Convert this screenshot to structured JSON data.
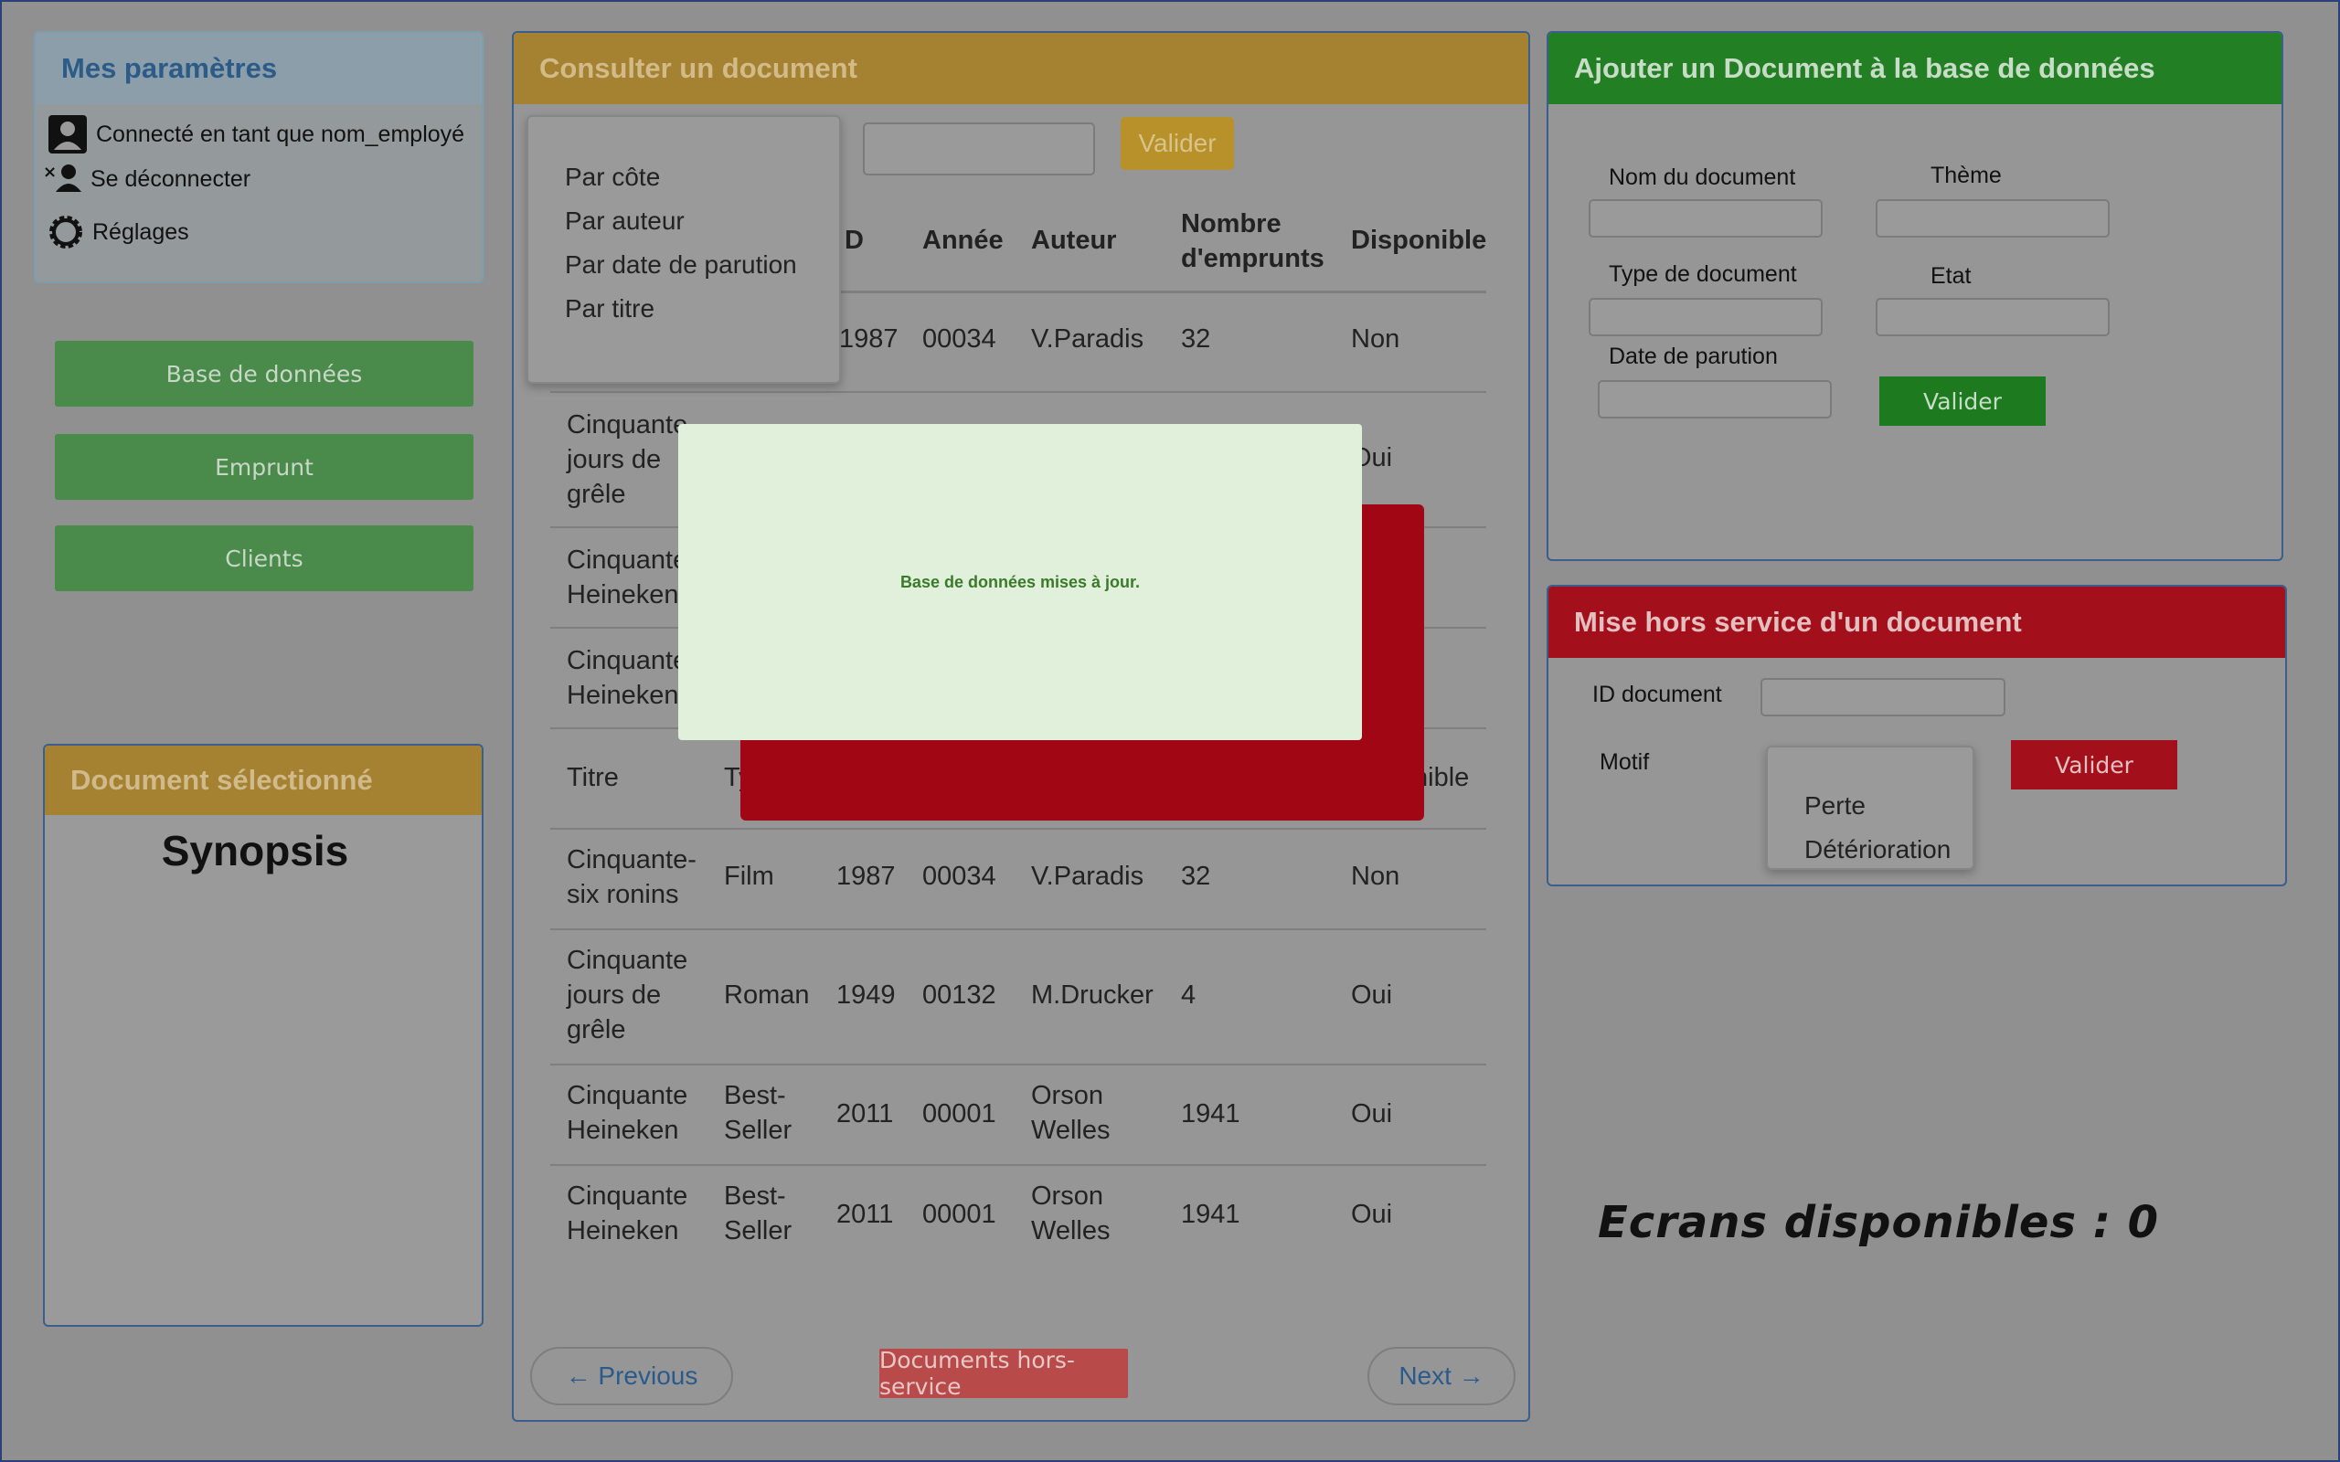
{
  "settings": {
    "title": "Mes paramètres",
    "logged_in": "Connecté en tant que nom_employé",
    "logout": "Se déconnecter",
    "settings": "Réglages"
  },
  "nav": {
    "database": "Base de données",
    "borrow": "Emprunt",
    "clients": "Clients"
  },
  "selected_doc": {
    "title": "Document sélectionné",
    "synopsis": "Synopsis"
  },
  "consult": {
    "title": "Consulter un document",
    "search_value": "",
    "validate": "Valider",
    "filter_options": [
      "Par côte",
      "Par auteur",
      "Par date de parution",
      "Par titre"
    ],
    "headers": {
      "titre": "Titre",
      "type": "Type",
      "id": "ID",
      "annee": "Année",
      "auteur": "Auteur",
      "emprunts": "Nombre d'emprunts",
      "disponible": "Disponible"
    },
    "rows": [
      {
        "titre": "Cinquante-six ronins",
        "type": "Film",
        "id": "1987",
        "annee": "00034",
        "auteur": "V.Paradis",
        "emprunts": "32",
        "disponible": "Non"
      },
      {
        "titre": "Cinquante jours de grêle",
        "type": "Roman",
        "id": "1949",
        "annee": "00132",
        "auteur": "M.Drucker",
        "emprunts": "4",
        "disponible": "Oui"
      },
      {
        "titre": "Cinquante Heineken",
        "type": "Best-Seller",
        "id": "2011",
        "annee": "00001",
        "auteur": "Orson Welles",
        "emprunts": "1941",
        "disponible": "Oui"
      },
      {
        "titre": "Cinquante Heineken",
        "type": "Best-Seller",
        "id": "2011",
        "annee": "00001",
        "auteur": "Orson Welles",
        "emprunts": "1941",
        "disponible": "Oui"
      }
    ],
    "partial": {
      "r1_id": "1987",
      "r1_annee": "00034",
      "r1_auteur": "V.Paradis",
      "r1_emprunts": "32",
      "r1_disp": "Non",
      "r2_titre": "Cinquante jours de grêle",
      "r2_disp": "Oui",
      "r3_titre": "Cinquante Heineken",
      "r4_titre": "Cinquante Heineken",
      "h2_titre": "Titre",
      "h2_type": "Ty",
      "h2_disp": "nible",
      "h1_id": "D"
    },
    "previous": "← Previous",
    "next": "Next →",
    "out_of_service": "Documents hors-service"
  },
  "modal": {
    "message": "Base de données mises à jour."
  },
  "add_doc": {
    "title": "Ajouter un Document à la base de données",
    "name_label": "Nom du document",
    "theme_label": "Thème",
    "type_label": "Type de document",
    "state_label": "Etat",
    "date_label": "Date de parution",
    "validate": "Valider"
  },
  "out_service": {
    "title": "Mise hors service d'un document",
    "id_label": "ID document",
    "motif_label": "Motif",
    "motif_options": [
      "Perte",
      "Détérioration"
    ],
    "validate": "Valider"
  },
  "screens": "Ecrans disponibles : 0",
  "colors": {
    "gold": "#a58232",
    "green": "#237f23",
    "red": "#a3101c",
    "blue_head": "#8c9eaa"
  }
}
